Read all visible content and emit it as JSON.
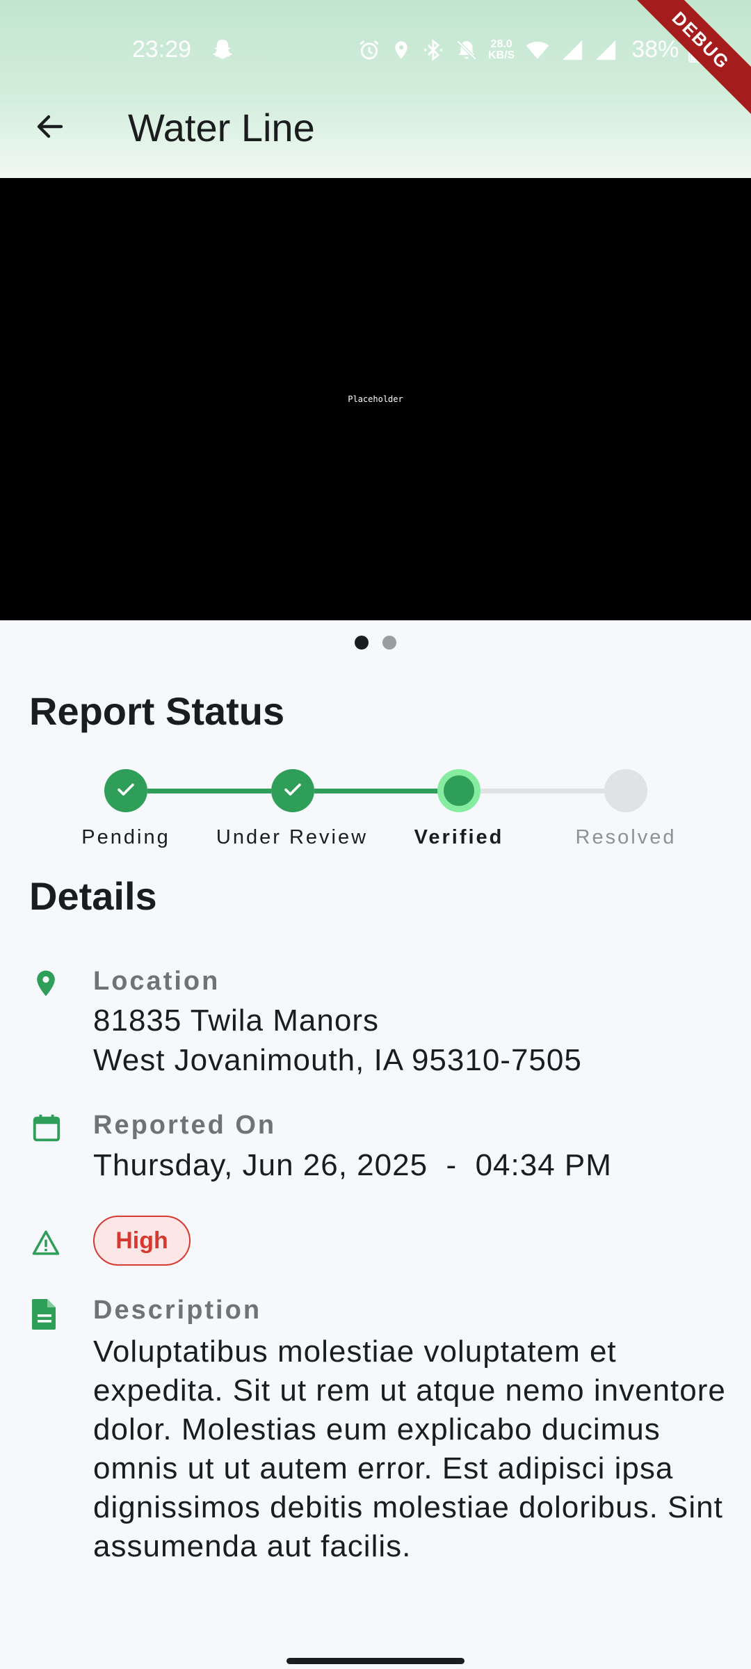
{
  "status_bar": {
    "time": "23:29",
    "network_speed_value": "28.0",
    "network_speed_unit": "KB/S",
    "battery": "38%"
  },
  "debug_banner": "DEBUG",
  "app_bar": {
    "title": "Water Line"
  },
  "image_carousel": {
    "placeholder_text": "Placeholder",
    "page_count": 2,
    "active_page": 1
  },
  "report_status": {
    "title": "Report Status",
    "steps": [
      {
        "label": "Pending",
        "state": "done"
      },
      {
        "label": "Under Review",
        "state": "done"
      },
      {
        "label": "Verified",
        "state": "current"
      },
      {
        "label": "Resolved",
        "state": "todo"
      }
    ]
  },
  "details": {
    "title": "Details",
    "location": {
      "label": "Location",
      "line1": "81835 Twila Manors",
      "line2": "West Jovanimouth, IA 95310-7505"
    },
    "reported_on": {
      "label": "Reported On",
      "value": "Thursday, Jun 26, 2025  -  04:34 PM"
    },
    "priority": {
      "value": "High"
    },
    "description": {
      "label": "Description",
      "value": "Voluptatibus molestiae voluptatem et expedita. Sit ut rem ut atque nemo inventore dolor. Molestias eum explicabo ducimus omnis ut ut autem error. Est adipisci ipsa dignissimos debitis molestiae doloribus. Sint assumenda aut facilis."
    }
  },
  "colors": {
    "accent_green": "#2E9E58",
    "current_ring": "#86ECA0",
    "priority_red": "#D6392F",
    "background": "#F6F8FC"
  },
  "icons": {
    "back": "arrow-back-icon",
    "location": "location-pin-icon",
    "reported_on": "calendar-icon",
    "priority": "warning-triangle-icon",
    "description": "document-icon"
  }
}
